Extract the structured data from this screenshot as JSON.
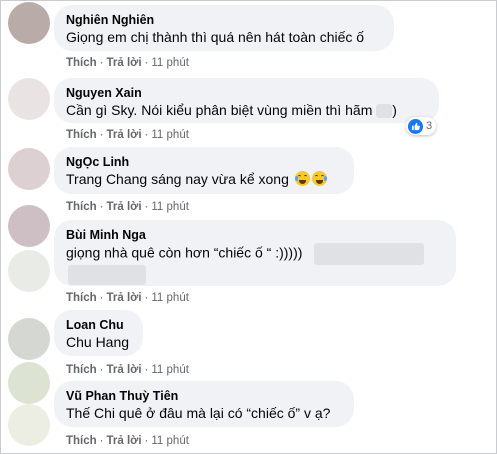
{
  "comments": [
    {
      "author": "Nghiên Nghiên",
      "text": "Giọng em chị thành thì quá nên hát toàn chiếc ố",
      "actions": {
        "like": "Thích",
        "reply": "Trả lời",
        "time": "11 phút"
      },
      "avatar_color": "#b9aca8"
    },
    {
      "author": "Nguyen Xain",
      "text": "Cần gì Sky. Nói kiểu phân biệt vùng miền thì hãm",
      "hidden_tail": ")",
      "reaction_count": "3",
      "actions": {
        "like": "Thích",
        "reply": "Trả lời",
        "time": "11 phút"
      },
      "avatar_color": "#e3dcdc"
    },
    {
      "author": "NgỌc Linh",
      "text": "Trang Chang sáng nay vừa kể xong",
      "actions": {
        "like": "Thích",
        "reply": "Trả lời",
        "time": "11 phút"
      },
      "avatar_color": "#d8c9cc"
    },
    {
      "author": "Bùi Minh Nga",
      "text": "giọng nhà quê còn hơn “chiếc ố “ :)))))",
      "actions": {
        "like": "Thích",
        "reply": "Trả lời",
        "time": "11 phút"
      },
      "avatar_color": "#e8eae6"
    },
    {
      "author": "Loan Chu",
      "text": "Chu Hang",
      "actions": {
        "like": "Thích",
        "reply": "Trả lời",
        "time": "11 phút"
      },
      "avatar_color": "#d5d8d2"
    },
    {
      "author": "Vũ Phan Thuỳ Tiên",
      "text": "Thế Chi quê ở đâu mà lại có “chiếc ố” v ạ?",
      "actions": {
        "like": "Thích",
        "reply": "Trả lời",
        "time": "11 phút"
      },
      "avatar_color": "#e4e8da"
    }
  ]
}
